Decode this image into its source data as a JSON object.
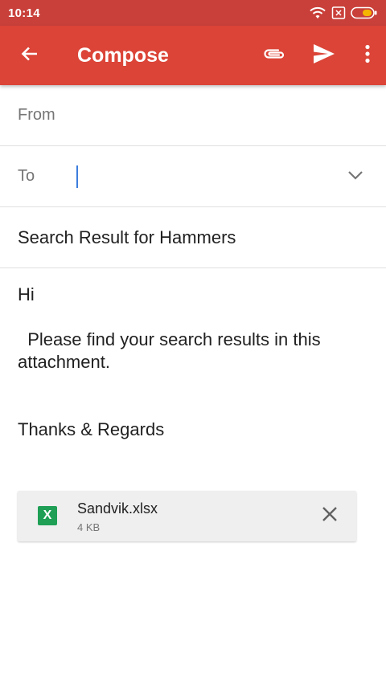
{
  "status_bar": {
    "time": "10:14",
    "icons": [
      "wifi-icon",
      "sim-icon",
      "battery-icon"
    ]
  },
  "app_bar": {
    "title": "Compose",
    "color": "#db4437",
    "actions": [
      "back-arrow-icon",
      "attach-icon",
      "send-icon",
      "more-vert-icon"
    ]
  },
  "form": {
    "from_label": "From",
    "to_label": "To",
    "to_value": "",
    "subject": "Search Result for Hammers"
  },
  "body": {
    "greeting": "Hi",
    "message": "  Please find your search results in this attachment.",
    "signoff": "Thanks & Regards"
  },
  "attachment": {
    "badge": "X",
    "name": "Sandvik.xlsx",
    "size": "4 KB",
    "icon_color": "#1e9f55"
  }
}
